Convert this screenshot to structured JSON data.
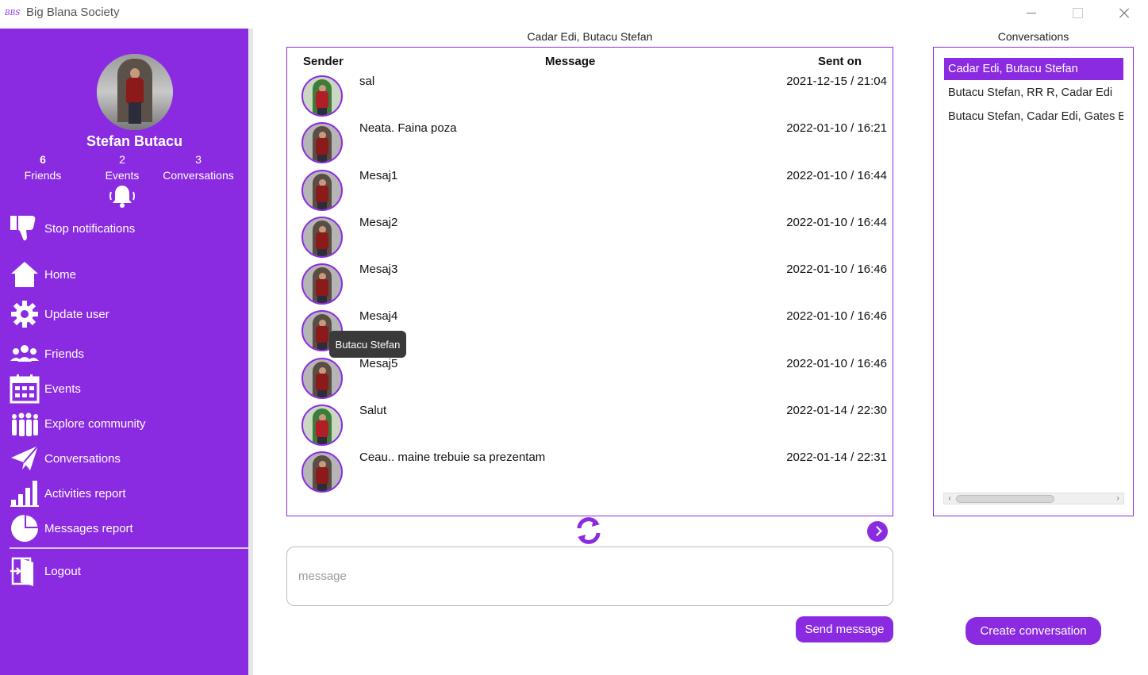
{
  "window": {
    "title": "Big Blana Society",
    "logo_text": "BBS"
  },
  "profile": {
    "name": "Stefan Butacu",
    "friends_count": "6",
    "friends_label": "Friends",
    "events_count": "2",
    "events_label": "Events",
    "conversations_count": "3",
    "conversations_label": "Conversations"
  },
  "nav": {
    "stop_notifications": "Stop notifications",
    "home": "Home",
    "update_user": "Update user",
    "friends": "Friends",
    "events": "Events",
    "explore_community": "Explore community",
    "conversations": "Conversations",
    "activities_report": "Activities report",
    "messages_report": "Messages report",
    "logout": "Logout"
  },
  "chat": {
    "title": "Cadar Edi, Butacu Stefan",
    "headers": {
      "sender": "Sender",
      "message": "Message",
      "sent_on": "Sent on"
    },
    "messages": [
      {
        "text": "sal",
        "date": "2021-12-15 / 21:04",
        "sender": "green"
      },
      {
        "text": "Neata. Faina poza",
        "date": "2022-01-10 / 16:21",
        "sender": "red"
      },
      {
        "text": "Mesaj1",
        "date": "2022-01-10 / 16:44",
        "sender": "red"
      },
      {
        "text": "Mesaj2",
        "date": "2022-01-10 / 16:44",
        "sender": "red"
      },
      {
        "text": "Mesaj3",
        "date": "2022-01-10 / 16:46",
        "sender": "red"
      },
      {
        "text": "Mesaj4",
        "date": "2022-01-10 / 16:46",
        "sender": "red"
      },
      {
        "text": "Mesaj5",
        "date": "2022-01-10 / 16:46",
        "sender": "red"
      },
      {
        "text": "Salut",
        "date": "2022-01-14 / 22:30",
        "sender": "green"
      },
      {
        "text": "Ceau.. maine trebuie sa prezentam",
        "date": "2022-01-14 / 22:31",
        "sender": "red"
      }
    ],
    "tooltip": "Butacu Stefan",
    "input_placeholder": "message",
    "send_label": "Send message"
  },
  "conversations": {
    "title": "Conversations",
    "items": [
      "Cadar Edi, Butacu Stefan",
      "Butacu Stefan, RR R, Cadar Edi",
      "Butacu Stefan, Cadar Edi, Gates Bill"
    ],
    "selected_index": 0,
    "create_label": "Create conversation"
  },
  "colors": {
    "accent": "#8a2be2",
    "tooltip_bg": "#3a3a3a"
  }
}
